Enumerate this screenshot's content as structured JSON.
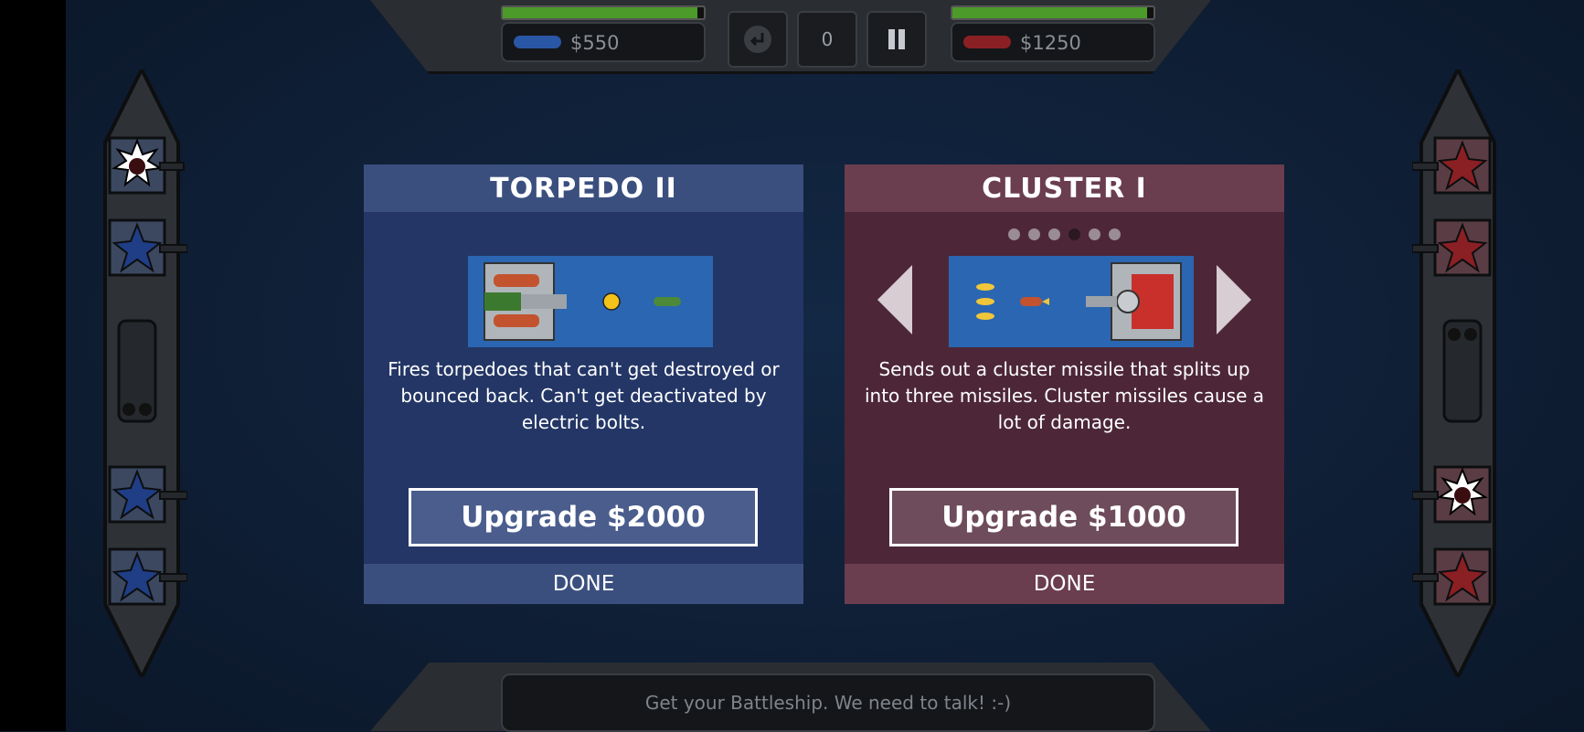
{
  "hud": {
    "player_blue": {
      "money": "$550",
      "hp_fraction": 0.97,
      "color": "#2a56a6"
    },
    "player_red": {
      "money": "$1250",
      "hp_fraction": 0.97,
      "color": "#8a1f24"
    },
    "center_counter": "0",
    "undo_icon": "undo-arrow-icon",
    "pause_icon": "pause-icon"
  },
  "panels": {
    "blue": {
      "title": "TORPEDO II",
      "description": "Fires torpedoes that can't get destroyed or bounced back. Can't get deactivated by electric bolts.",
      "upgrade_label": "Upgrade $2000",
      "done_label": "DONE",
      "colors": {
        "bg": "#233666",
        "header": "#3b4f7f"
      }
    },
    "red": {
      "title": "CLUSTER I",
      "description": "Sends out a cluster missile that splits up into three missiles. Cluster missiles cause a lot of damage.",
      "upgrade_label": "Upgrade $1000",
      "done_label": "DONE",
      "carousel": {
        "count": 6,
        "active_index": 3
      },
      "colors": {
        "bg": "#4d2738",
        "header": "#6a3d4f"
      }
    }
  },
  "chat": {
    "message": "Get your Battleship. We need to talk! :-)"
  }
}
